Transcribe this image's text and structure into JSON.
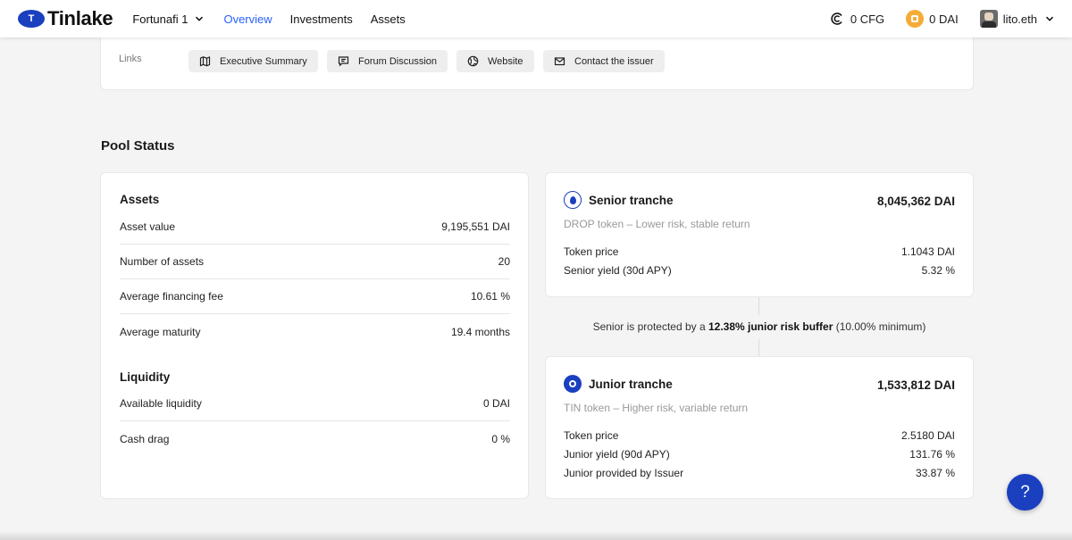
{
  "header": {
    "logo_letter": "T",
    "logo_text": "Tinlake",
    "pool": "Fortunafi 1",
    "nav": [
      "Overview",
      "Investments",
      "Assets"
    ],
    "cfg_balance": "0 CFG",
    "dai_balance": "0 DAI",
    "account": "lito.eth",
    "accent": "#2762ff"
  },
  "links": {
    "label": "Links",
    "items": [
      {
        "label": "Executive Summary",
        "icon": "map-icon"
      },
      {
        "label": "Forum Discussion",
        "icon": "chat-icon"
      },
      {
        "label": "Website",
        "icon": "globe-icon"
      },
      {
        "label": "Contact the issuer",
        "icon": "mail-icon"
      }
    ]
  },
  "pool_status": {
    "title": "Pool Status",
    "assets": {
      "title": "Assets",
      "rows": [
        {
          "label": "Asset value",
          "value": "9,195,551 DAI"
        },
        {
          "label": "Number of assets",
          "value": "20"
        },
        {
          "label": "Average financing fee",
          "value": "10.61 %"
        },
        {
          "label": "Average maturity",
          "value": "19.4 months"
        }
      ]
    },
    "liquidity": {
      "title": "Liquidity",
      "rows": [
        {
          "label": "Available liquidity",
          "value": "0 DAI"
        },
        {
          "label": "Cash drag",
          "value": "0 %"
        }
      ]
    }
  },
  "senior": {
    "name": "Senior tranche",
    "total": "8,045,362 DAI",
    "subtitle": "DROP token – Lower risk, stable return",
    "rows": [
      {
        "label": "Token price",
        "value": "1.1043 DAI"
      },
      {
        "label": "Senior yield (30d APY)",
        "value": "5.32 %"
      }
    ]
  },
  "buffer": {
    "prefix": "Senior is protected by a ",
    "bold": "12.38% junior risk buffer",
    "suffix": " (10.00% minimum)"
  },
  "junior": {
    "name": "Junior tranche",
    "total": "1,533,812 DAI",
    "subtitle": "TIN token – Higher risk, variable return",
    "rows": [
      {
        "label": "Token price",
        "value": "2.5180 DAI"
      },
      {
        "label": "Junior yield (90d APY)",
        "value": "131.76 %"
      },
      {
        "label": "Junior provided by Issuer",
        "value": "33.87 %"
      }
    ]
  },
  "help": {
    "label": "?"
  },
  "colors": {
    "brand": "#1a3fbf",
    "dai": "#f5ac37"
  }
}
